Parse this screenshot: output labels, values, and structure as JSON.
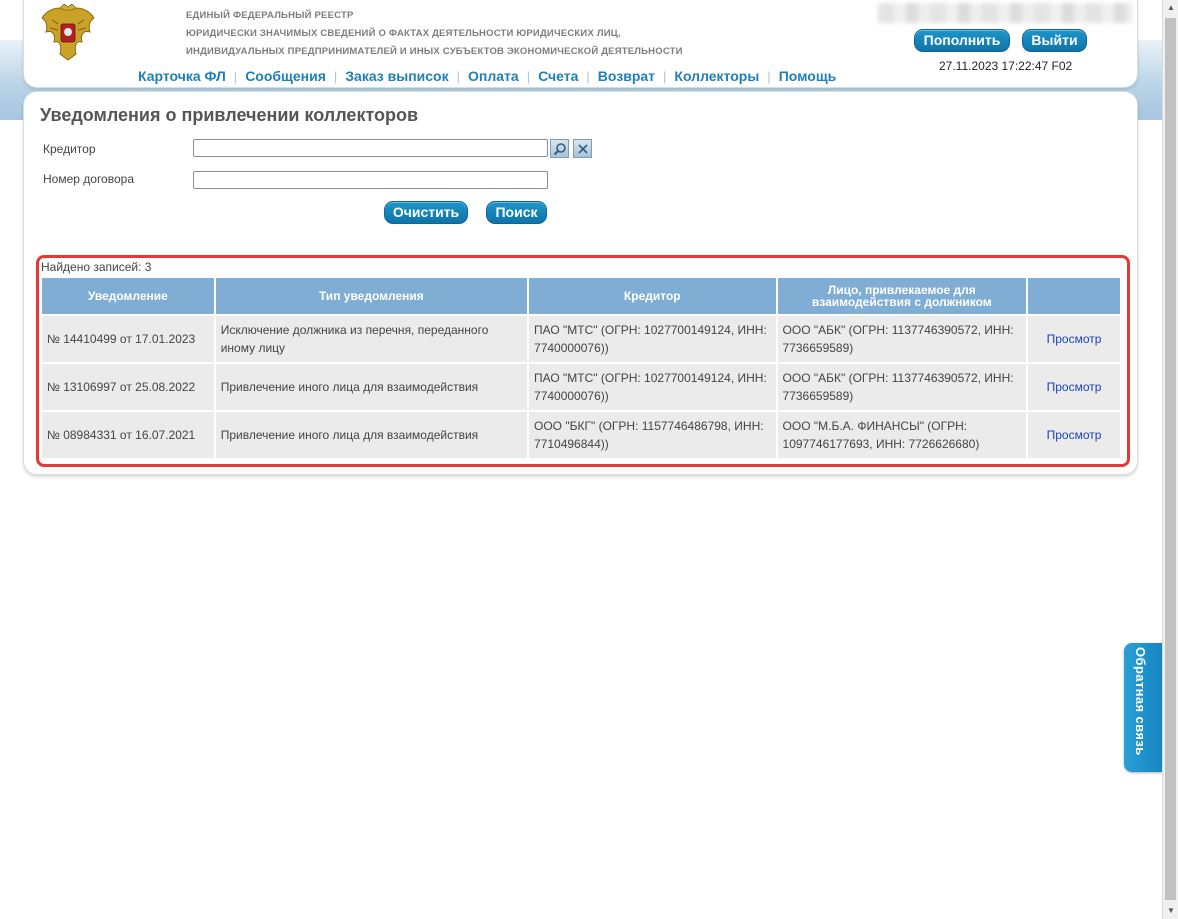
{
  "header": {
    "registry_lines": [
      "ЕДИНЫЙ ФЕДЕРАЛЬНЫЙ РЕЕСТР",
      "ЮРИДИЧЕСКИ ЗНАЧИМЫХ СВЕДЕНИЙ О ФАКТАХ ДЕЯТЕЛЬНОСТИ ЮРИДИЧЕСКИХ ЛИЦ,",
      "ИНДИВИДУАЛЬНЫХ ПРЕДПРИНИМАТЕЛЕЙ И ИНЫХ СУБЪЕКТОВ ЭКОНОМИЧЕСКОЙ ДЕЯТЕЛЬНОСТИ"
    ],
    "topup_label": "Пополнить",
    "logout_label": "Выйти",
    "datetime": "27.11.2023 17:22:47 F02"
  },
  "nav": {
    "items": [
      "Карточка ФЛ",
      "Сообщения",
      "Заказ выписок",
      "Оплата",
      "Счета",
      "Возврат",
      "Коллекторы",
      "Помощь"
    ]
  },
  "page": {
    "title": "Уведомления о привлечении коллекторов",
    "creditor_label": "Кредитор",
    "creditor_value": "",
    "contract_label": "Номер договора",
    "contract_value": "",
    "clear_label": "Очистить",
    "search_label": "Поиск",
    "found_text": "Найдено записей: 3"
  },
  "table": {
    "headers": [
      "Уведомление",
      "Тип уведомления",
      "Кредитор",
      "Лицо, привлекаемое для взаимодействия с должником",
      ""
    ],
    "rows": [
      {
        "notice": "№ 14410499 от 17.01.2023",
        "type": "Исключение должника из перечня, переданного иному лицу",
        "creditor": "ПАО \"МТС\" (ОГРН: 1027700149124, ИНН: 7740000076))",
        "agent": "ООО \"АБК\" (ОГРН: 1137746390572, ИНН: 7736659589)",
        "action": "Просмотр"
      },
      {
        "notice": "№ 13106997 от 25.08.2022",
        "type": "Привлечение иного лица для взаимодействия",
        "creditor": "ПАО \"МТС\" (ОГРН: 1027700149124, ИНН: 7740000076))",
        "agent": "ООО \"АБК\" (ОГРН: 1137746390572, ИНН: 7736659589)",
        "action": "Просмотр"
      },
      {
        "notice": "№ 08984331 от 16.07.2021",
        "type": "Привлечение иного лица для взаимодействия",
        "creditor": "ООО \"БКГ\" (ОГРН: 1157746486798, ИНН: 7710496844))",
        "agent": "ООО \"М.Б.А. ФИНАНСЫ\" (ОГРН: 1097746177693, ИНН: 7726626680)",
        "action": "Просмотр"
      }
    ]
  },
  "feedback_label": "Обратная связь",
  "colors": {
    "accent": "#1f7fb8",
    "button": "#1483bc",
    "table_header": "#7fadd3",
    "highlight": "#e53935"
  }
}
